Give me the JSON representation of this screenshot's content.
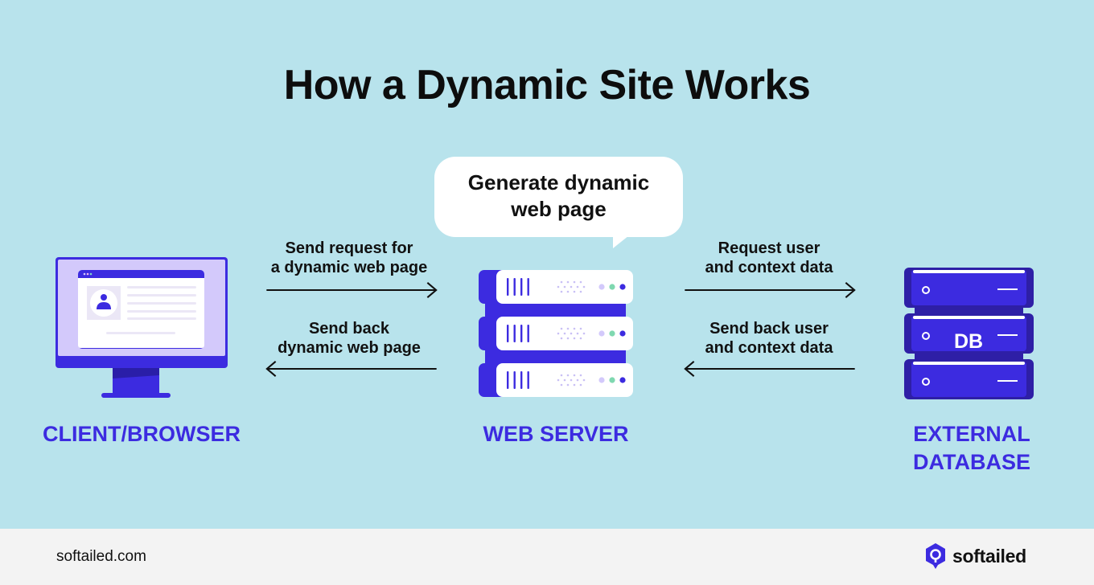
{
  "title": "How a Dynamic Site Works",
  "bubble": {
    "line1": "Generate dynamic",
    "line2": "web page"
  },
  "arrows": [
    {
      "id": "send-request",
      "line1": "Send request for",
      "line2": "a dynamic web page",
      "direction": "right"
    },
    {
      "id": "send-back-page",
      "line1": "Send back",
      "line2": "dynamic web page",
      "direction": "left"
    },
    {
      "id": "request-user-data",
      "line1": "Request user",
      "line2": "and context data",
      "direction": "right"
    },
    {
      "id": "send-back-user-data",
      "line1": "Send back user",
      "line2": "and context data",
      "direction": "left"
    }
  ],
  "nodes": {
    "client": {
      "label": "CLIENT/BROWSER",
      "icon": "monitor-icon"
    },
    "server": {
      "label": "WEB SERVER",
      "icon": "server-icon"
    },
    "database": {
      "line1": "EXTERNAL",
      "line2": "DATABASE",
      "icon": "database-icon",
      "badge": "DB"
    }
  },
  "footer": {
    "url": "softailed.com",
    "brand": "softailed"
  },
  "colors": {
    "background": "#b8e3ec",
    "accent": "#3c2be0",
    "footer_bg": "#f3f3f3"
  }
}
